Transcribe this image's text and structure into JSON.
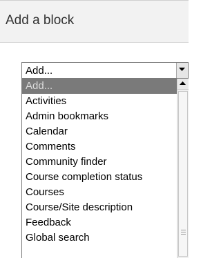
{
  "block": {
    "title": "Add a block"
  },
  "select": {
    "value": "Add...",
    "arrow_icon": "chevron-down-icon"
  },
  "dropdown": {
    "options": [
      "Add...",
      "Activities",
      "Admin bookmarks",
      "Calendar",
      "Comments",
      "Community finder",
      "Course completion status",
      "Courses",
      "Course/Site description",
      "Feedback",
      "Global search"
    ],
    "selected_index": 0
  },
  "scrollbar": {
    "up_icon": "chevron-up-icon",
    "grip_icon": "grip-lines-icon"
  },
  "colors": {
    "header_bg": "#f2f2f2",
    "selected_bg": "#7a7a7a",
    "selected_text": "#dcdcdc"
  }
}
